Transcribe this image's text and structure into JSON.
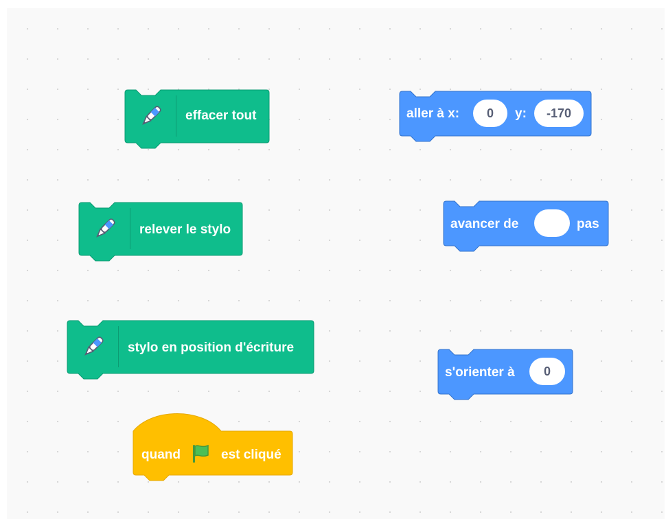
{
  "canvas": {
    "name": "scripts-area"
  },
  "pen_blocks": [
    {
      "label": "effacer tout"
    },
    {
      "label": "relever le stylo"
    },
    {
      "label": "stylo en position d'écriture"
    }
  ],
  "event_block": {
    "label_before": "quand",
    "label_after": "est cliqué",
    "icon": "green-flag-icon"
  },
  "motion_blocks": {
    "goto": {
      "label_x": "aller à x:",
      "x_value": "0",
      "label_y": "y:",
      "y_value": "-170"
    },
    "move": {
      "label_before": "avancer de",
      "value": "",
      "label_after": "pas"
    },
    "point": {
      "label": "s'orienter à",
      "value": "0"
    }
  },
  "colors": {
    "pen": "#0fbd8c",
    "motion": "#4c97ff",
    "event": "#ffbf00",
    "canvas": "#f9f9f9"
  }
}
